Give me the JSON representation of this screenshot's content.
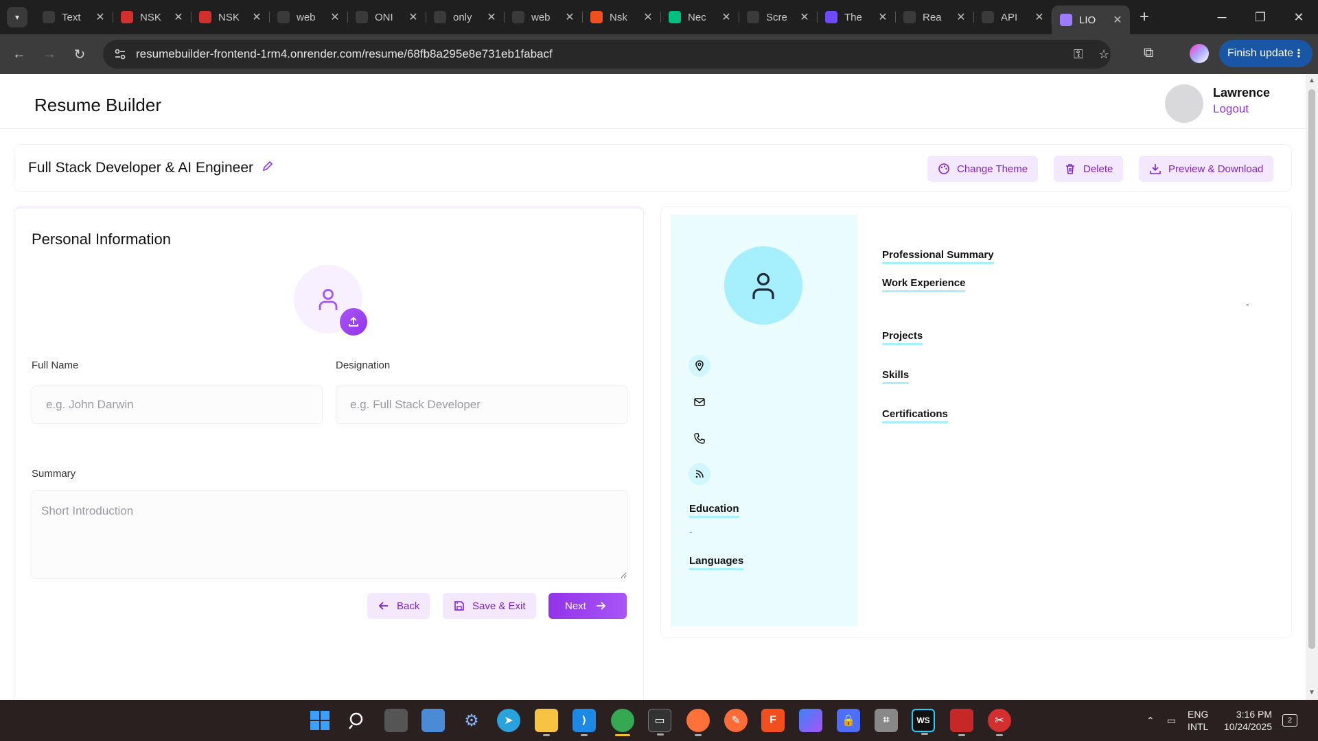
{
  "browser": {
    "tabs": [
      {
        "title": "Text",
        "icon": "openai-icon",
        "color": "#3a3a3a"
      },
      {
        "title": "NSK",
        "icon": "nsk-icon",
        "color": "#d32f2f"
      },
      {
        "title": "NSK",
        "icon": "nsk-icon",
        "color": "#d32f2f"
      },
      {
        "title": "web",
        "icon": "github-icon",
        "color": "#3a3a3a"
      },
      {
        "title": "ONI",
        "icon": "vercel-icon",
        "color": "#3a3a3a"
      },
      {
        "title": "only",
        "icon": "github-icon",
        "color": "#3a3a3a"
      },
      {
        "title": "web",
        "icon": "vercel-icon",
        "color": "#3a3a3a"
      },
      {
        "title": "Nsk",
        "icon": "figma-icon",
        "color": "#f24e1e"
      },
      {
        "title": "Nec",
        "icon": "neon-icon",
        "color": "#00c07f"
      },
      {
        "title": "Scre",
        "icon": "pen-icon",
        "color": "#3a3a3a"
      },
      {
        "title": "The",
        "icon": "app-icon",
        "color": "#6d4aff"
      },
      {
        "title": "Rea",
        "icon": "react-icon",
        "color": "#3a3a3a"
      },
      {
        "title": "API",
        "icon": "r-icon",
        "color": "#3a3a3a"
      },
      {
        "title": "LIO",
        "icon": "vite-icon",
        "color": "#9d7cff",
        "active": true
      }
    ],
    "url": "resumebuilder-frontend-1rm4.onrender.com/resume/68fb8a295e8e731eb1fabacf",
    "finish_update": "Finish update"
  },
  "header": {
    "brand": "Resume Builder",
    "user_name": "Lawrence",
    "logout": "Logout"
  },
  "resume": {
    "title": "Full Stack Developer & AI Engineer",
    "actions": {
      "change_theme": "Change Theme",
      "delete": "Delete",
      "preview_download": "Preview & Download"
    }
  },
  "form": {
    "section_title": "Personal Information",
    "full_name": {
      "label": "Full Name",
      "value": "",
      "placeholder": "e.g. John Darwin"
    },
    "designation": {
      "label": "Designation",
      "value": "",
      "placeholder": "e.g. Full Stack Developer"
    },
    "summary": {
      "label": "Summary",
      "value": "",
      "placeholder": "Short Introduction"
    },
    "buttons": {
      "back": "Back",
      "save_exit": "Save & Exit",
      "next": "Next"
    }
  },
  "preview": {
    "education": "Education",
    "education_value": "-",
    "languages": "Languages",
    "professional_summary": "Professional Summary",
    "work_experience": "Work Experience",
    "work_dash": "-",
    "projects": "Projects",
    "skills": "Skills",
    "certifications": "Certifications",
    "accent": "#a5f0fc"
  },
  "taskbar": {
    "lang_top": "ENG",
    "lang_bottom": "INTL",
    "time": "3:16 PM",
    "date": "10/24/2025",
    "notif_count": "2"
  }
}
